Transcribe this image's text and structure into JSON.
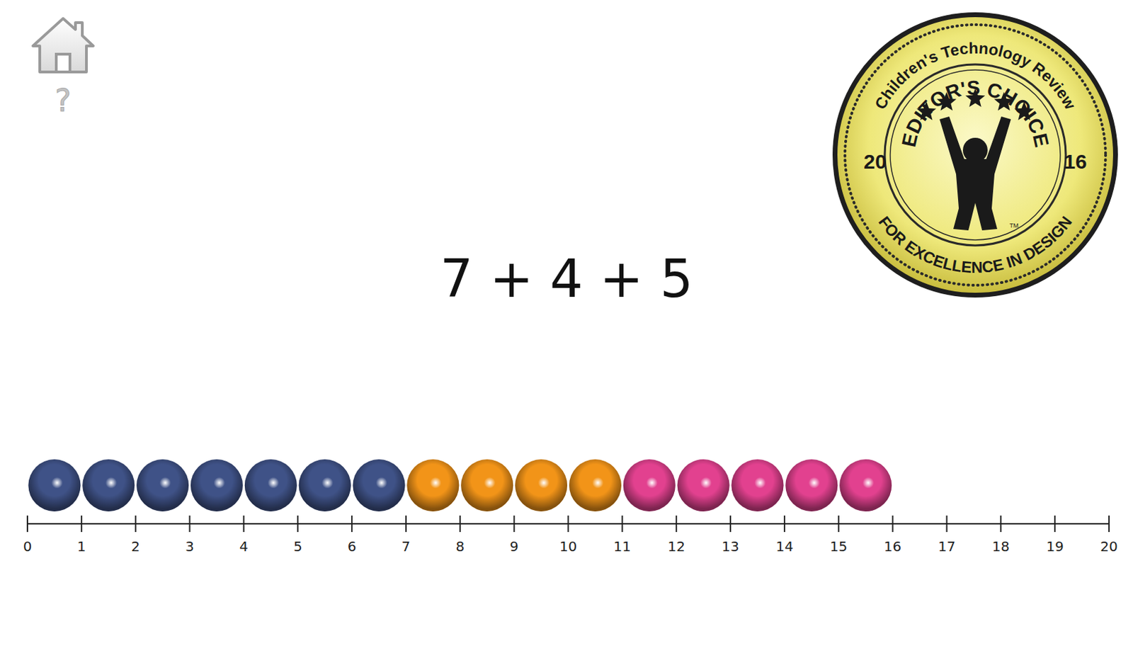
{
  "nav": {
    "help": "?"
  },
  "equation": "7 + 4 + 5",
  "groups": [
    {
      "count": 7,
      "color": "#3f5287"
    },
    {
      "count": 4,
      "color": "#f29418"
    },
    {
      "count": 5,
      "color": "#e2418f"
    }
  ],
  "axis": {
    "ticks": [
      "0",
      "1",
      "2",
      "3",
      "4",
      "5",
      "6",
      "7",
      "8",
      "9",
      "10",
      "11",
      "12",
      "13",
      "14",
      "15",
      "16",
      "17",
      "18",
      "19",
      "20"
    ]
  },
  "badge": {
    "top": "Children's Technology Review",
    "title": "EDITOR'S CHOICE",
    "year_left": "20",
    "year_right": "16",
    "bottom": "FOR EXCELLENCE IN DESIGN",
    "mark": "TM",
    "stars": 5
  }
}
